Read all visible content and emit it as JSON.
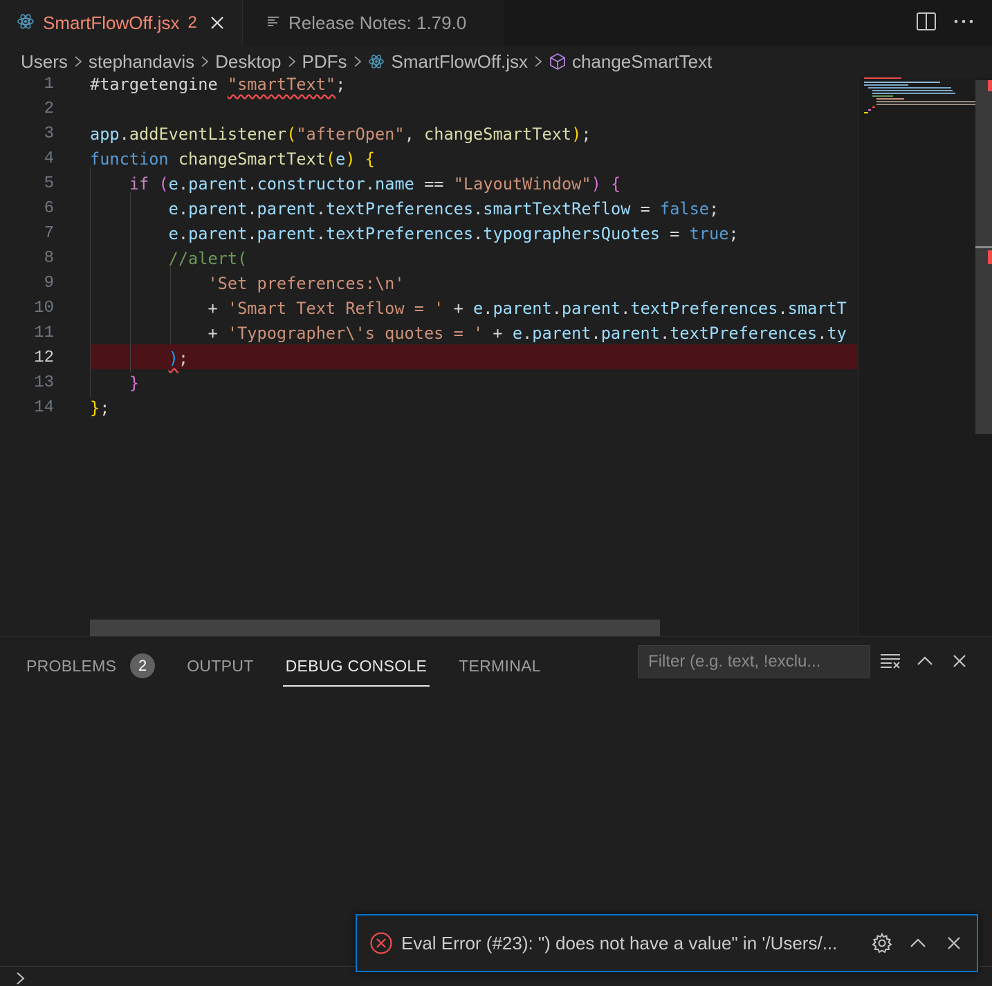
{
  "tabs": [
    {
      "title": "SmartFlowOff.jsx",
      "count": "2",
      "icon": "react-icon",
      "active": true
    },
    {
      "title": "Release Notes: 1.79.0",
      "icon": "preview-icon",
      "active": false
    }
  ],
  "breadcrumb": [
    "Users",
    "stephandavis",
    "Desktop",
    "PDFs",
    "SmartFlowOff.jsx",
    "changeSmartText"
  ],
  "editor": {
    "line_numbers": [
      "1",
      "2",
      "3",
      "4",
      "5",
      "6",
      "7",
      "8",
      "9",
      "10",
      "11",
      "12",
      "13",
      "14"
    ],
    "active_line": "12",
    "lines": [
      [
        [
          "pl",
          "#targetengine "
        ],
        [
          "str squig",
          "\"smartText\""
        ],
        [
          "pl",
          ";"
        ]
      ],
      [],
      [
        [
          "id",
          "app"
        ],
        [
          "pl",
          "."
        ],
        [
          "fn",
          "addEventListener"
        ],
        [
          "br1",
          "("
        ],
        [
          "str",
          "\"afterOpen\""
        ],
        [
          "pl",
          ", "
        ],
        [
          "fn",
          "changeSmartText"
        ],
        [
          "br1",
          ")"
        ],
        [
          "pl",
          ";"
        ]
      ],
      [
        [
          "kw",
          "function "
        ],
        [
          "fn",
          "changeSmartText"
        ],
        [
          "br1",
          "("
        ],
        [
          "id",
          "e"
        ],
        [
          "br1",
          ")"
        ],
        [
          "pl",
          " "
        ],
        [
          "br1",
          "{"
        ]
      ],
      [
        [
          "pl",
          "    "
        ],
        [
          "ctl",
          "if "
        ],
        [
          "br2",
          "("
        ],
        [
          "id",
          "e"
        ],
        [
          "pl",
          "."
        ],
        [
          "id",
          "parent"
        ],
        [
          "pl",
          "."
        ],
        [
          "id",
          "constructor"
        ],
        [
          "pl",
          "."
        ],
        [
          "id",
          "name"
        ],
        [
          "pl",
          " == "
        ],
        [
          "str",
          "\"LayoutWindow\""
        ],
        [
          "br2",
          ")"
        ],
        [
          "pl",
          " "
        ],
        [
          "br2",
          "{"
        ]
      ],
      [
        [
          "pl",
          "        "
        ],
        [
          "id",
          "e"
        ],
        [
          "pl",
          "."
        ],
        [
          "id",
          "parent"
        ],
        [
          "pl",
          "."
        ],
        [
          "id",
          "parent"
        ],
        [
          "pl",
          "."
        ],
        [
          "id",
          "textPreferences"
        ],
        [
          "pl",
          "."
        ],
        [
          "id",
          "smartTextReflow"
        ],
        [
          "pl",
          " = "
        ],
        [
          "kw",
          "false"
        ],
        [
          "pl",
          ";"
        ]
      ],
      [
        [
          "pl",
          "        "
        ],
        [
          "id",
          "e"
        ],
        [
          "pl",
          "."
        ],
        [
          "id",
          "parent"
        ],
        [
          "pl",
          "."
        ],
        [
          "id",
          "parent"
        ],
        [
          "pl",
          "."
        ],
        [
          "id",
          "textPreferences"
        ],
        [
          "pl",
          "."
        ],
        [
          "id",
          "typographersQuotes"
        ],
        [
          "pl",
          " = "
        ],
        [
          "kw",
          "true"
        ],
        [
          "pl",
          ";"
        ]
      ],
      [
        [
          "pl",
          "        "
        ],
        [
          "cm",
          "//alert("
        ]
      ],
      [
        [
          "pl",
          "            "
        ],
        [
          "str",
          "'Set preferences:\\n'"
        ]
      ],
      [
        [
          "pl",
          "            + "
        ],
        [
          "str",
          "'Smart Text Reflow = '"
        ],
        [
          "pl",
          " + "
        ],
        [
          "id",
          "e"
        ],
        [
          "pl",
          "."
        ],
        [
          "id",
          "parent"
        ],
        [
          "pl",
          "."
        ],
        [
          "id",
          "parent"
        ],
        [
          "pl",
          "."
        ],
        [
          "id",
          "textPreferences"
        ],
        [
          "pl",
          "."
        ],
        [
          "id",
          "smartT"
        ]
      ],
      [
        [
          "pl",
          "            + "
        ],
        [
          "str",
          "'Typographer\\'s quotes = '"
        ],
        [
          "pl",
          " + "
        ],
        [
          "id",
          "e"
        ],
        [
          "pl",
          "."
        ],
        [
          "id",
          "parent"
        ],
        [
          "pl",
          "."
        ],
        [
          "id",
          "parent"
        ],
        [
          "pl",
          "."
        ],
        [
          "id",
          "textPreferences"
        ],
        [
          "pl",
          "."
        ],
        [
          "id",
          "ty"
        ]
      ],
      [
        [
          "pl",
          "        "
        ],
        [
          "br3 squig",
          ")"
        ],
        [
          "pl",
          ";"
        ]
      ],
      [
        [
          "pl",
          "    "
        ],
        [
          "br2",
          "}"
        ]
      ],
      [
        [
          "br1",
          "}"
        ],
        [
          "pl",
          ";"
        ]
      ]
    ]
  },
  "panel": {
    "tabs": [
      {
        "label": "PROBLEMS",
        "badge": "2"
      },
      {
        "label": "OUTPUT"
      },
      {
        "label": "DEBUG CONSOLE",
        "active": true
      },
      {
        "label": "TERMINAL"
      }
    ],
    "filter_placeholder": "Filter (e.g. text, !exclu..."
  },
  "notification": {
    "message": "Eval Error (#23): \") does not have a value\" in '/Users/...",
    "severity": "error"
  },
  "colors": {
    "accent": "#0078d4",
    "error": "#f14c4c",
    "error_line_bg": "#4b1217",
    "tab_active_text": "#f48771"
  }
}
